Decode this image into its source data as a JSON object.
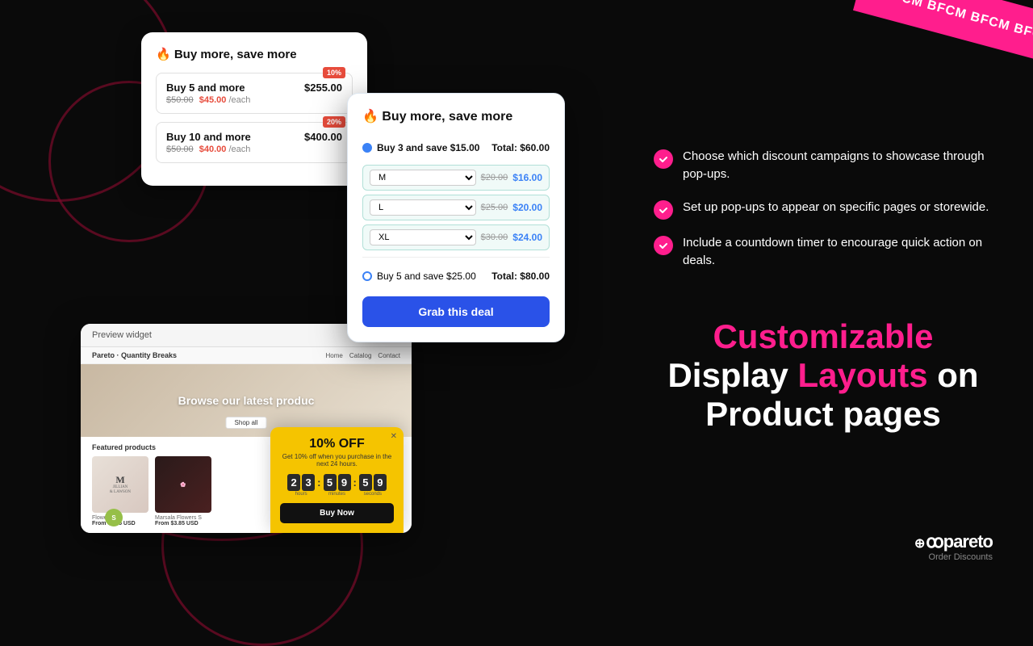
{
  "bfcm": {
    "text": "BFCM BFCM BFCM BFCM"
  },
  "card1": {
    "title": "🔥 Buy more, save more",
    "row1": {
      "label": "Buy 5 and more",
      "price": "$255.00",
      "original": "$50.00",
      "discounted": "$45.00",
      "per": "/each",
      "badge": "10%"
    },
    "row2": {
      "label": "Buy 10 and more",
      "price": "$400.00",
      "original": "$50.00",
      "discounted": "$40.00",
      "per": "/each",
      "badge": "20%"
    }
  },
  "card2": {
    "title": "🔥 Buy more, save more",
    "option1": {
      "label": "Buy 3 and save $15.00",
      "total": "Total: $60.00",
      "selected": true
    },
    "sizes": [
      {
        "size": "M",
        "original": "$20.00",
        "discounted": "$16.00"
      },
      {
        "size": "L",
        "original": "$25.00",
        "discounted": "$20.00"
      },
      {
        "size": "XL",
        "original": "$30.00",
        "discounted": "$24.00"
      }
    ],
    "option2": {
      "label": "Buy 5 and save $25.00",
      "total": "Total: $80.00",
      "selected": false
    },
    "cta": "Grab this deal"
  },
  "card3": {
    "header": "Preview widget",
    "nav": {
      "logo": "Pareto · Quantity Breaks",
      "links": [
        "Home",
        "Catalog",
        "Contact"
      ]
    },
    "hero": {
      "text": "Browse our latest produc",
      "btn": "Shop all"
    },
    "featured_label": "Featured products",
    "products": [
      {
        "name": "Flowers S",
        "price": "From $3.85 USD"
      },
      {
        "name": "Marsala Flowers S",
        "price": "From $3.85 USD"
      }
    ]
  },
  "popup": {
    "title": "10% OFF",
    "subtitle": "Get 10% off when you purchase in the next 24 hours.",
    "countdown": {
      "hours": [
        "2",
        "3"
      ],
      "minutes": [
        "5",
        "9"
      ],
      "seconds": [
        "5",
        "9"
      ],
      "hours_label": "hours",
      "minutes_label": "minutes",
      "seconds_label": "seconds"
    },
    "cta": "Buy Now"
  },
  "features": [
    "Choose which discount campaigns to showcase through pop-ups.",
    "Set up pop-ups to appear on specific pages or storewide.",
    "Include a countdown timer to encourage quick action on deals."
  ],
  "headline": {
    "line1a": "Customizable",
    "line2a": "Display ",
    "line2b": "Layouts",
    "line2c": " on",
    "line3": "Product pages"
  },
  "branding": {
    "logo": "ꝏpareto",
    "sub": "Order Discounts"
  }
}
